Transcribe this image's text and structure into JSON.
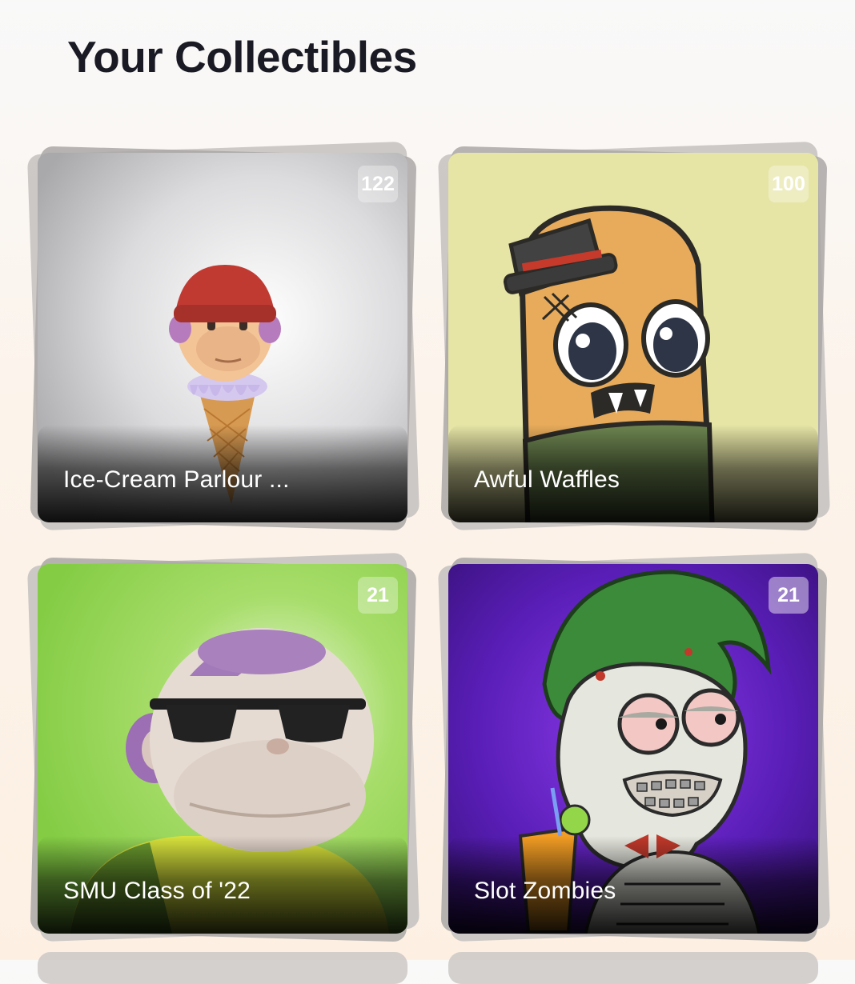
{
  "page": {
    "title": "Your Collectibles"
  },
  "collections": [
    {
      "name": "Ice-Cream Parlour ...",
      "count": "122"
    },
    {
      "name": "Awful Waffles",
      "count": "100"
    },
    {
      "name": "SMU Class of '22",
      "count": "21"
    },
    {
      "name": "Slot Zombies",
      "count": "21"
    }
  ],
  "colors": {
    "title": "#191a24",
    "background_top": "#f9f9f9",
    "background_bottom": "#fdf0e3",
    "card_text": "#ffffff"
  }
}
